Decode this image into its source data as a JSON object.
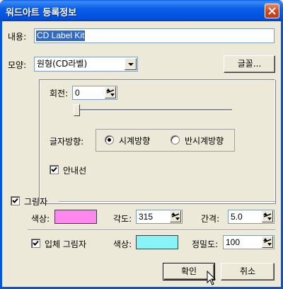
{
  "window": {
    "title": "워드아트 등록정보"
  },
  "content": {
    "label": "내용:",
    "value": "CD Label Kit"
  },
  "shape": {
    "label": "모양:",
    "selected": "원형(CD라벨)"
  },
  "font_button": "글꼴...",
  "rotation": {
    "label": "회전:",
    "value": "0"
  },
  "direction": {
    "label": "글자방향:",
    "options": [
      {
        "label": "시계방향",
        "selected": true
      },
      {
        "label": "반시계방향",
        "selected": false
      }
    ]
  },
  "guide": {
    "label": "안내선",
    "checked": true
  },
  "shadow": {
    "label": "그림자",
    "checked": true,
    "color_label": "색상:",
    "color": "#ff88ee",
    "angle_label": "각도:",
    "angle": "315",
    "spacing_label": "간격:",
    "spacing": "5.0"
  },
  "solid_shadow": {
    "label": "입체 그림자",
    "checked": true,
    "color_label": "색상:",
    "color": "#88f4f8",
    "precision_label": "정밀도:",
    "precision": "100"
  },
  "buttons": {
    "ok": "확인",
    "cancel": "취소"
  },
  "colors": {
    "title_bar": "#0a5fe8",
    "selection": "#316ac5",
    "dialog_bg": "#ece9d8"
  }
}
